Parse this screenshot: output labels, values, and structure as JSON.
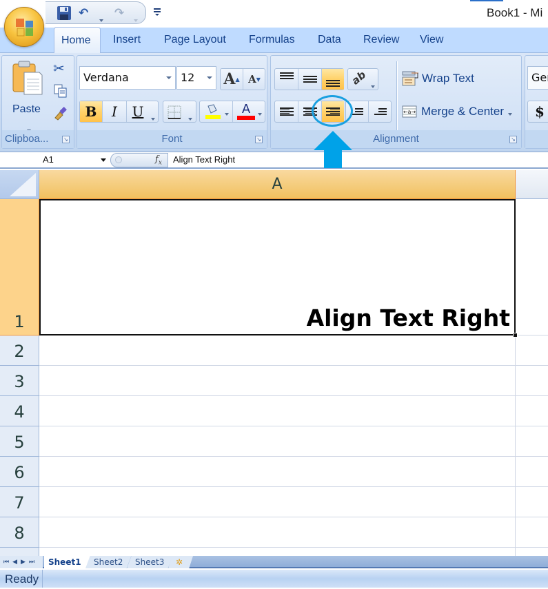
{
  "window": {
    "title": "Book1 - Mi"
  },
  "quick_access": {
    "icons": [
      "save-icon",
      "undo-icon",
      "redo-icon",
      "customize-icon"
    ]
  },
  "ribbon_tabs": [
    {
      "label": "Home",
      "active": true
    },
    {
      "label": "Insert"
    },
    {
      "label": "Page Layout"
    },
    {
      "label": "Formulas"
    },
    {
      "label": "Data"
    },
    {
      "label": "Review"
    },
    {
      "label": "View"
    }
  ],
  "clipboard": {
    "label": "Clipboa...",
    "paste_label": "Paste",
    "icons": [
      "cut-icon",
      "copy-icon",
      "format-painter-icon"
    ]
  },
  "font": {
    "label": "Font",
    "font_name": "Verdana",
    "font_size": "12",
    "bold": "B",
    "italic": "I",
    "underline": "U",
    "font_color_letter": "A",
    "fill_color": "#ffff00",
    "font_color": "#ff0000"
  },
  "alignment": {
    "label": "Alignment",
    "wrap_text": "Wrap Text",
    "merge_center": "Merge & Center",
    "active_horizontal": "align-right",
    "active_vertical": "bottom-align"
  },
  "number": {
    "format": "Ger",
    "currency": "$"
  },
  "formula_bar": {
    "name_box": "A1",
    "fx": "fx",
    "content": "Align Text Right"
  },
  "grid": {
    "corner": "",
    "columns": [
      "A"
    ],
    "rows": [
      "1",
      "2",
      "3",
      "4",
      "5",
      "6",
      "7",
      "8"
    ],
    "selected_cell": "A1",
    "cell_A1": "Align Text Right"
  },
  "sheets": [
    {
      "label": "Sheet1",
      "active": true
    },
    {
      "label": "Sheet2"
    },
    {
      "label": "Sheet3"
    }
  ],
  "status": {
    "text": "Ready"
  },
  "annotation": {
    "color": "#1aa0e0",
    "target": "align-right-button"
  }
}
